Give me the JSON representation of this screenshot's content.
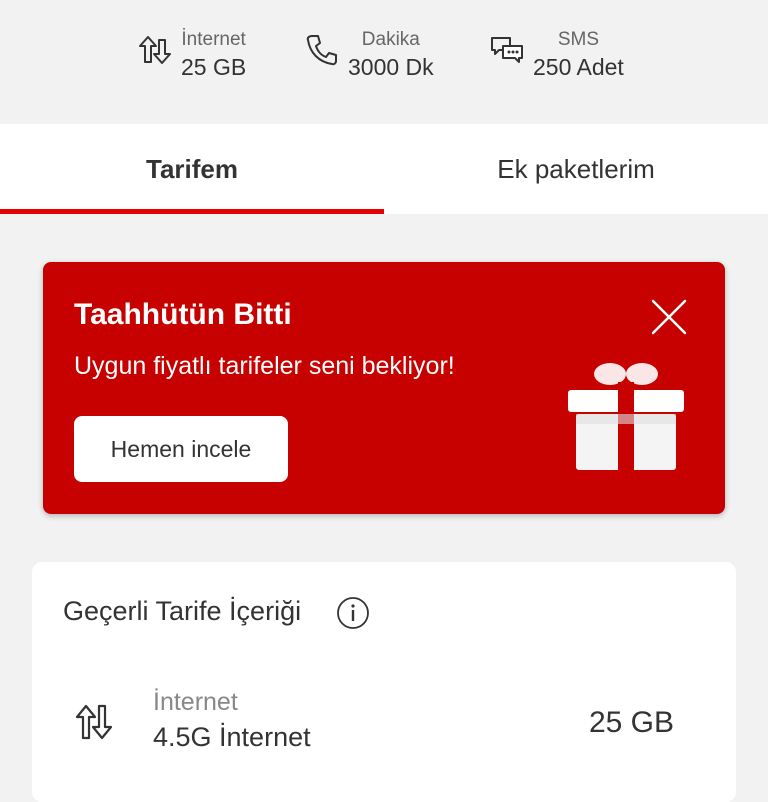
{
  "summary": {
    "internet": {
      "label": "İnternet",
      "value": "25 GB",
      "icon": "data-arrows-icon"
    },
    "minutes": {
      "label": "Dakika",
      "value": "3000 Dk",
      "icon": "phone-icon"
    },
    "sms": {
      "label": "SMS",
      "value": "250 Adet",
      "icon": "chat-bubbles-icon"
    }
  },
  "tabs": [
    {
      "label": "Tarifem",
      "active": true
    },
    {
      "label": "Ek paketlerim",
      "active": false
    }
  ],
  "promo": {
    "title": "Taahhütün Bitti",
    "subtitle": "Uygun fiyatlı tarifeler seni bekliyor!",
    "button": "Hemen incele",
    "background": "#c70000",
    "icon": "gift-icon",
    "close_icon": "close-icon"
  },
  "tariff": {
    "title": "Geçerli Tarife İçeriği",
    "info_icon": "info-icon",
    "rows": [
      {
        "label": "İnternet",
        "sub": "4.5G İnternet",
        "value": "25 GB",
        "icon": "data-arrows-icon"
      }
    ]
  },
  "colors": {
    "accent": "#e60000",
    "background": "#f2f2f2",
    "card": "#ffffff"
  }
}
